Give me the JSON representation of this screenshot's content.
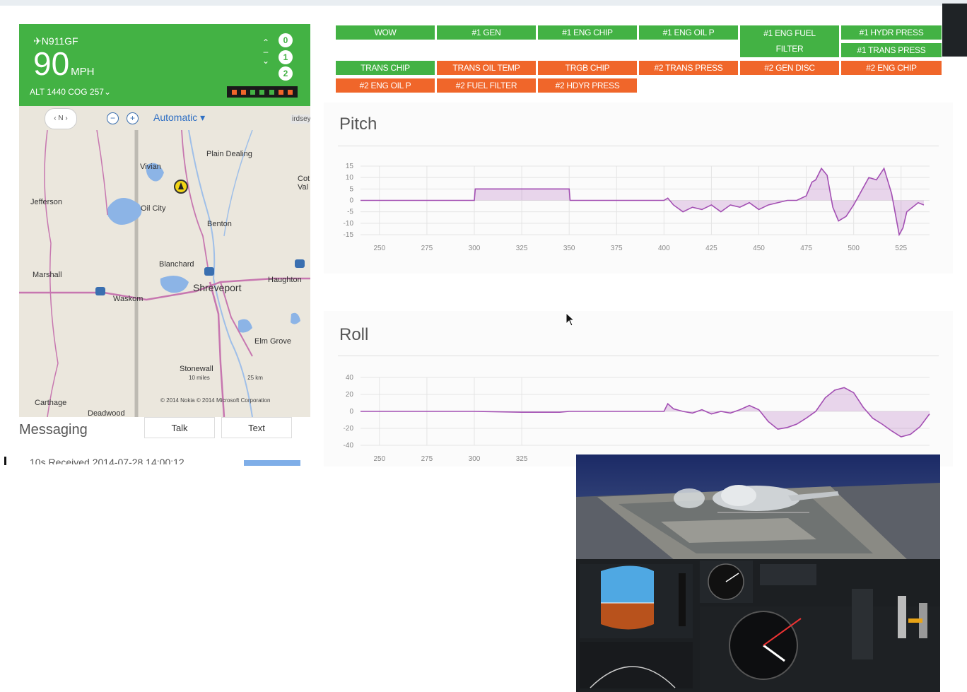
{
  "aircraft": {
    "tail_number": "N911GF",
    "speed": "90",
    "speed_unit": "MPH",
    "alt_cog": "ALT 1440 COG 257",
    "alt_levels": [
      "0",
      "1",
      "2"
    ]
  },
  "map": {
    "compass_label": "N",
    "zoom_out": "−",
    "zoom_in": "+",
    "mode": "Automatic ▾",
    "birdseye": "irdseye",
    "places": {
      "plain_dealing": "Plain Dealing",
      "vivian": "Vivian",
      "cot_val": "Cot Val",
      "jefferson": "Jefferson",
      "oil_city": "Oil City",
      "benton": "Benton",
      "blanchard": "Blanchard",
      "marshall": "Marshall",
      "shreveport": "Shreveport",
      "haughton": "Haughton",
      "waskom": "Waskom",
      "elm_grove": "Elm Grove",
      "stonewall": "Stonewall",
      "carthage": "Carthage",
      "deadwood": "Deadwood"
    },
    "scale_miles": "10 miles",
    "scale_km": "25 km",
    "copyright": "© 2014 Nokia  © 2014 Microsoft Corporation"
  },
  "messaging": {
    "title": "Messaging",
    "talk_label": "Talk",
    "text_label": "Text",
    "received": "10s  Received 2014-07-28 14:00:12"
  },
  "warnings": {
    "row1": [
      "WOW",
      "#1 GEN",
      "#1 ENG CHIP",
      "#1 ENG OIL P",
      "#1 ENG FUEL FILTER",
      "#1 HYDR PRESS",
      "#1 TRANS PRESS"
    ],
    "row2": [
      "TRANS CHIP",
      "TRANS OIL TEMP",
      "TRGB CHIP",
      "#2 TRANS PRESS",
      "#2 GEN DISC",
      "#2 ENG CHIP"
    ],
    "row3": [
      "#2 ENG OIL P",
      "#2 FUEL FILTER",
      "#2 HDYR PRESS"
    ],
    "colors": {
      "ok": "#43b244",
      "alert": "#f0662a"
    }
  },
  "chart_data": [
    {
      "type": "area",
      "title": "Pitch",
      "x_ticks": [
        250,
        275,
        300,
        325,
        350,
        375,
        400,
        425,
        450,
        475,
        500,
        525
      ],
      "y_ticks": [
        15,
        10,
        5,
        0,
        -5,
        -10,
        -15
      ],
      "xlim": [
        240,
        540
      ],
      "ylim": [
        -15,
        15
      ],
      "color": "#a34fb3",
      "x": [
        240,
        300,
        300.5,
        350,
        350.5,
        400,
        402,
        405,
        410,
        415,
        420,
        425,
        430,
        435,
        440,
        445,
        450,
        455,
        460,
        465,
        470,
        475,
        478,
        480,
        483,
        486,
        489,
        492,
        496,
        500,
        504,
        508,
        512,
        516,
        520,
        524,
        526,
        528,
        531,
        534,
        537
      ],
      "y": [
        0,
        0,
        5,
        5,
        0,
        0,
        1,
        -2,
        -5,
        -3,
        -4,
        -2,
        -5,
        -2,
        -3,
        -1,
        -4,
        -2,
        -1,
        0,
        0,
        2,
        8,
        9,
        14,
        11,
        -3,
        -9,
        -7,
        -2,
        4,
        10,
        9,
        14,
        3,
        -15,
        -12,
        -5,
        -3,
        -1,
        -2
      ]
    },
    {
      "type": "area",
      "title": "Roll",
      "x_ticks": [
        250,
        275,
        300,
        325
      ],
      "y_ticks": [
        40,
        20,
        0,
        -20,
        -40
      ],
      "xlim": [
        240,
        540
      ],
      "ylim": [
        -40,
        40
      ],
      "color": "#a34fb3",
      "x": [
        240,
        300,
        325,
        345,
        350,
        365,
        380,
        395,
        400,
        402,
        405,
        410,
        415,
        420,
        425,
        430,
        435,
        440,
        445,
        450,
        455,
        460,
        465,
        470,
        475,
        480,
        485,
        490,
        495,
        500,
        505,
        510,
        515,
        520,
        525,
        530,
        535,
        540
      ],
      "y": [
        0,
        0,
        -1,
        -1,
        0,
        0,
        0,
        0,
        0,
        9,
        3,
        0,
        -2,
        2,
        -3,
        0,
        -2,
        2,
        7,
        2,
        -12,
        -21,
        -19,
        -15,
        -8,
        0,
        16,
        25,
        28,
        22,
        5,
        -8,
        -15,
        -23,
        -30,
        -27,
        -18,
        -3
      ]
    }
  ]
}
